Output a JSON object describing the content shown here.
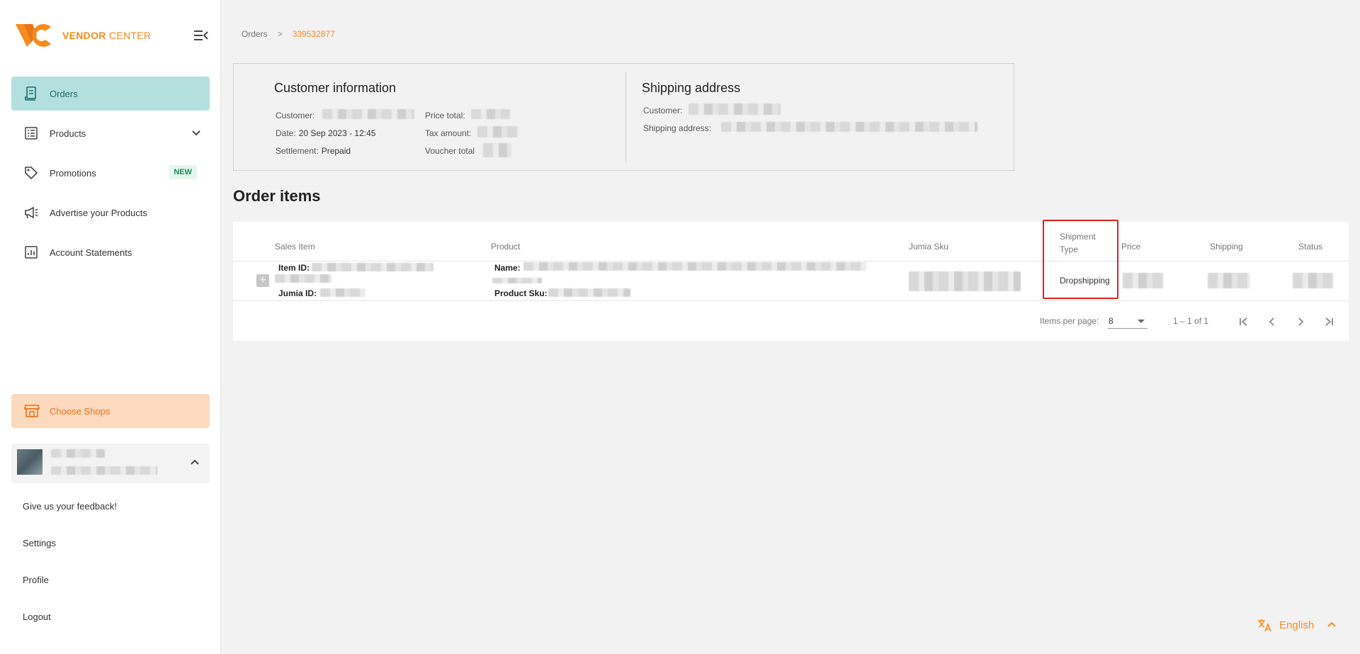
{
  "app": {
    "logo_brand": "VENDOR",
    "logo_suffix": "CENTER"
  },
  "sidebar": {
    "items": [
      {
        "label": "Orders",
        "icon": "receipt-icon",
        "active": true
      },
      {
        "label": "Products",
        "icon": "list-icon",
        "expandable": true
      },
      {
        "label": "Promotions",
        "icon": "tag-icon",
        "badge": "NEW"
      },
      {
        "label": "Advertise your Products",
        "icon": "megaphone-icon"
      },
      {
        "label": "Account Statements",
        "icon": "chart-icon"
      }
    ],
    "choose_shops": "Choose Shops",
    "links": [
      "Give us your feedback!",
      "Settings",
      "Profile",
      "Logout"
    ]
  },
  "breadcrumb": {
    "root": "Orders",
    "separator": ">",
    "current": "339532877"
  },
  "customer_info": {
    "title": "Customer information",
    "customer_label": "Customer:",
    "date_label": "Date:",
    "date_value": "20 Sep 2023 - 12:45",
    "settlement_label": "Settlement:",
    "settlement_value": "Prepaid",
    "price_total_label": "Price total:",
    "tax_amount_label": "Tax amount:",
    "voucher_total_label": "Voucher total"
  },
  "shipping_address": {
    "title": "Shipping address",
    "customer_label": "Customer:",
    "address_label": "Shipping address:"
  },
  "order_items": {
    "title": "Order items",
    "columns": [
      "Sales Item",
      "Product",
      "Jumia Sku",
      "Shipment Type",
      "Price",
      "Shipping",
      "Status"
    ],
    "shipment_type_line1": "Shipment",
    "shipment_type_line2": "Type",
    "row": {
      "item_id_label": "Item ID:",
      "jumia_id_label": "Jumia ID:",
      "name_label": "Name:",
      "product_sku_label": "Product Sku:",
      "shipment_type": "Dropshipping"
    }
  },
  "pagination": {
    "items_per_page_label": "Items per page:",
    "items_per_page": "8",
    "range": "1 – 1 of 1"
  },
  "language": {
    "label": "English"
  },
  "colors": {
    "brand_orange": "#f68b1e",
    "active_nav": "#b3e0df",
    "highlight_red": "#e02020"
  }
}
